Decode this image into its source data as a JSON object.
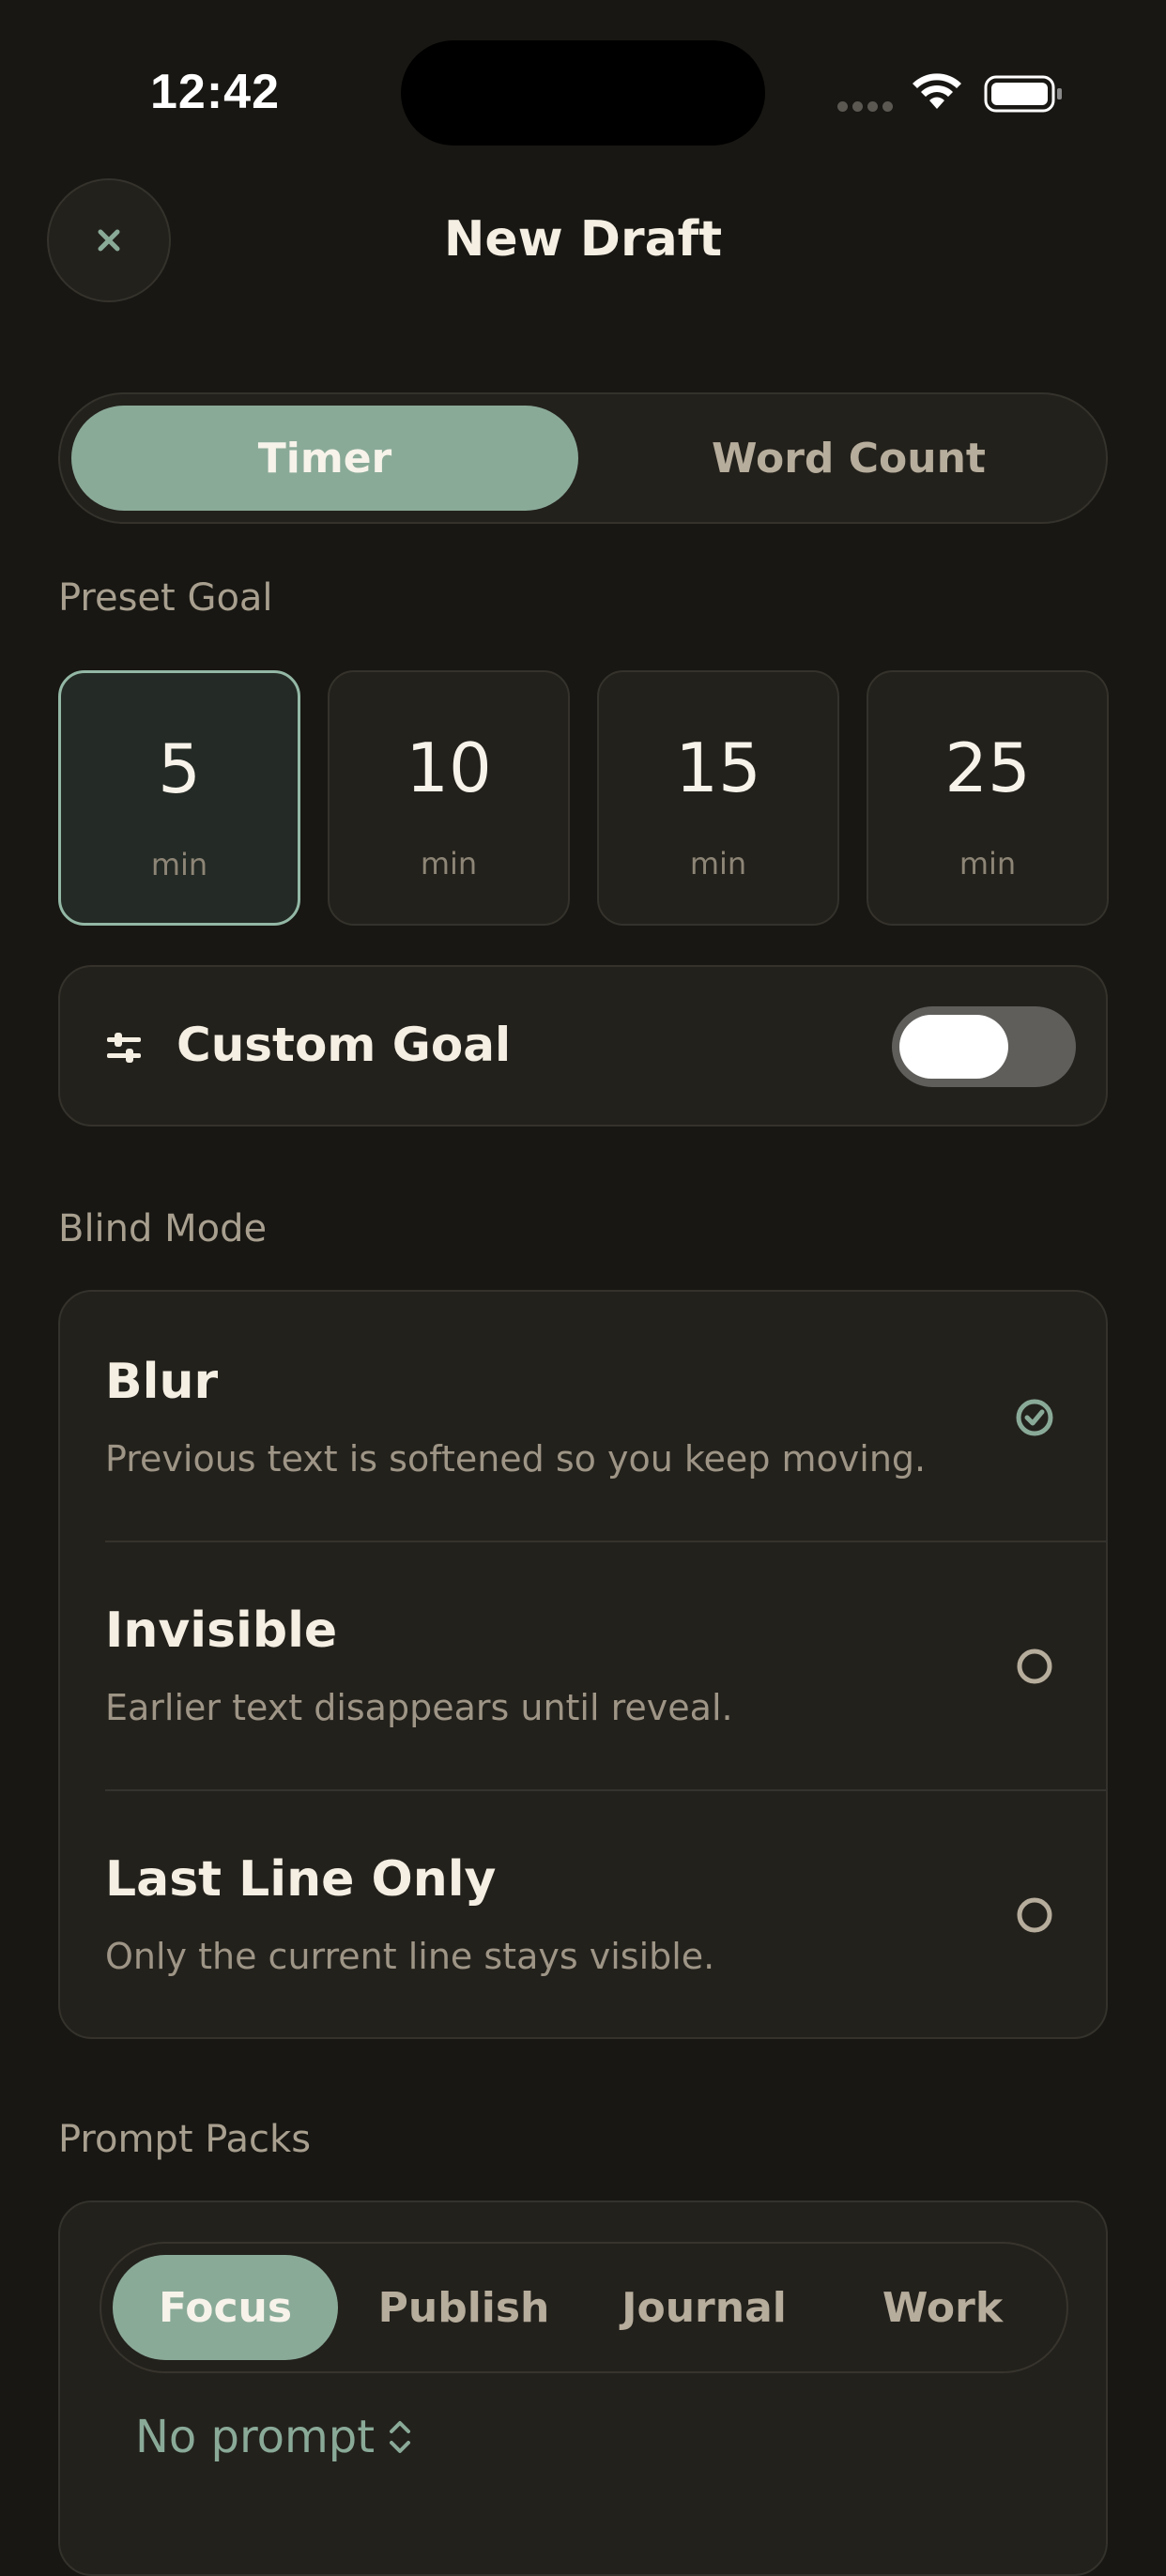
{
  "status_bar": {
    "time": "12:42"
  },
  "header": {
    "title": "New Draft",
    "close_icon": "close-icon"
  },
  "mode_segment": {
    "options": [
      "Timer",
      "Word Count"
    ],
    "selected": "Timer"
  },
  "preset_goal": {
    "label": "Preset Goal",
    "options": [
      {
        "value": "5",
        "unit": "min",
        "selected": true
      },
      {
        "value": "10",
        "unit": "min",
        "selected": false
      },
      {
        "value": "15",
        "unit": "min",
        "selected": false
      },
      {
        "value": "25",
        "unit": "min",
        "selected": false
      }
    ]
  },
  "custom_goal": {
    "label": "Custom Goal",
    "icon": "sliders-icon",
    "toggle_on": false
  },
  "blind_mode": {
    "label": "Blind Mode",
    "options": [
      {
        "title": "Blur",
        "description": "Previous text is softened so you keep moving.",
        "selected": true
      },
      {
        "title": "Invisible",
        "description": "Earlier text disappears until reveal.",
        "selected": false
      },
      {
        "title": "Last Line Only",
        "description": "Only the current line stays visible.",
        "selected": false
      }
    ]
  },
  "prompt_packs": {
    "label": "Prompt Packs",
    "tabs": [
      "Focus",
      "Publish",
      "Journal",
      "Work"
    ],
    "selected": "Focus",
    "prompt_value": "No prompt"
  },
  "colors": {
    "accent": "#8aaa98",
    "background": "#181713",
    "card": "#23211c"
  }
}
